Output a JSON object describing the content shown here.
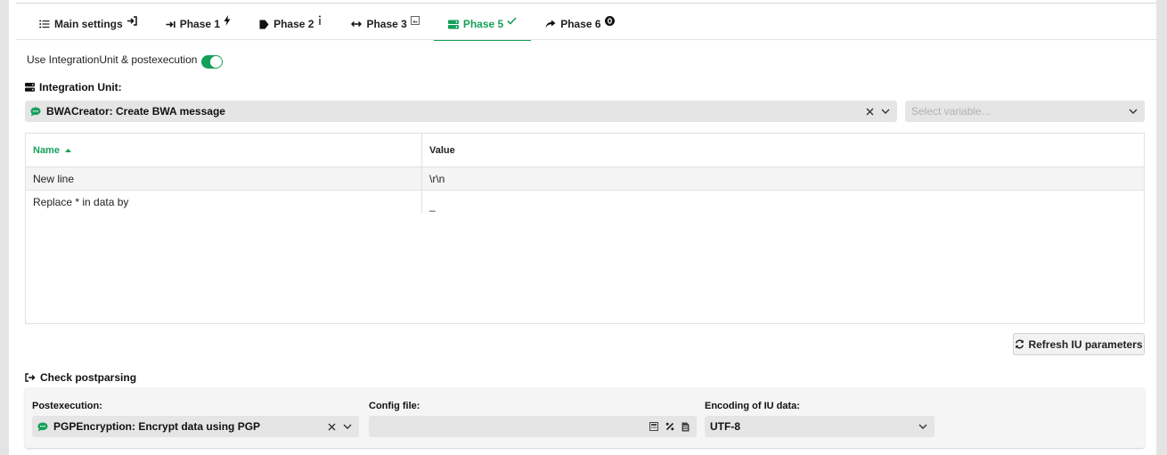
{
  "tabs": [
    {
      "label": "Main settings",
      "icon": "list-icon",
      "badge": "login-arrow-icon",
      "active": false
    },
    {
      "label": "Phase 1",
      "icon": "arrow-to-bar-icon",
      "badge": "bolt-icon",
      "active": false
    },
    {
      "label": "Phase 2",
      "icon": "tag-icon",
      "badge": "vertical-dots-icon",
      "active": false
    },
    {
      "label": "Phase 3",
      "icon": "left-right-arrows-icon",
      "badge": "image-square-icon",
      "active": false
    },
    {
      "label": "Phase 5",
      "icon": "server-icon",
      "badge": "check-icon",
      "active": true
    },
    {
      "label": "Phase 6",
      "icon": "share-arrow-icon",
      "badge": "zero-circle-icon",
      "active": false
    }
  ],
  "toggle": {
    "label": "Use IntegrationUnit & postexecution",
    "on": true,
    "color": "#14a05a"
  },
  "integration_unit": {
    "heading": "Integration Unit:",
    "selected": "BWACreator: Create BWA message",
    "variable_placeholder": "Select variable..."
  },
  "table": {
    "columns": [
      "Name",
      "Value"
    ],
    "rows": [
      {
        "name": "New line",
        "value": "\\r\\n"
      },
      {
        "name": "Replace * in data by",
        "value": "_"
      }
    ]
  },
  "refresh_button": "Refresh IU parameters",
  "postparsing": {
    "heading": "Check postparsing",
    "postexecution_label": "Postexecution:",
    "postexecution_value": "PGPEncryption: Encrypt data using PGP",
    "config_label": "Config file:",
    "config_value": "",
    "encoding_label": "Encoding of IU data:",
    "encoding_value": "UTF-8"
  },
  "colors": {
    "accent": "#16a05a",
    "field_bg": "#e5e5e5"
  }
}
